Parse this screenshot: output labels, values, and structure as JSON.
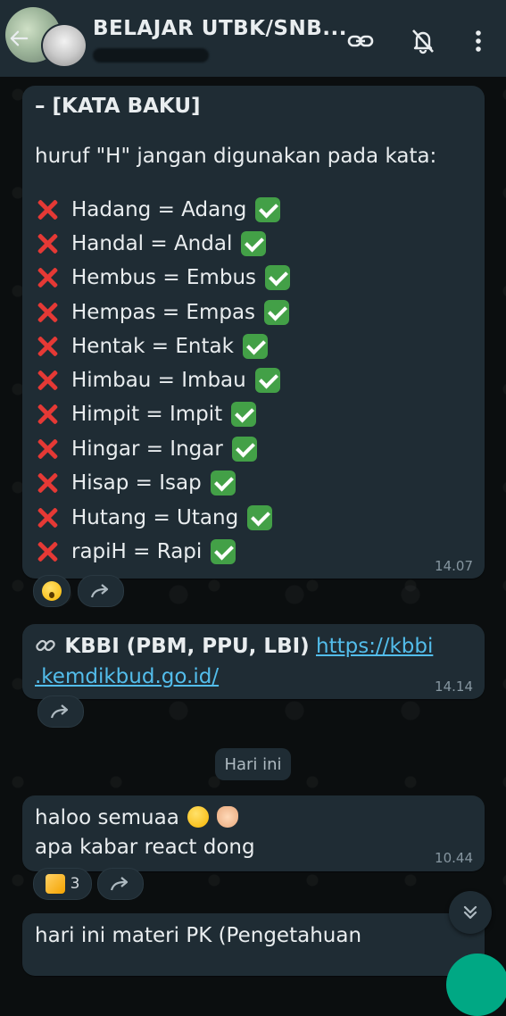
{
  "header": {
    "title": "BELAJAR UTBK/SNB...",
    "icons": [
      "back-arrow-icon",
      "link-icon",
      "bell-off-icon",
      "more-vert-icon"
    ]
  },
  "messages": {
    "m1": {
      "heading": "– [KATA BAKU]",
      "intro": "huruf \"H\" jangan digunakan pada kata:",
      "rules": [
        "Hadang = Adang",
        "Handal = Andal",
        "Hembus = Embus",
        "Hempas = Empas",
        "Hentak = Entak",
        "Himbau = Imbau",
        "Himpit = Impit",
        "Hingar = Ingar",
        "Hisap = Isap",
        "Hutang = Utang",
        "rapiH = Rapi"
      ],
      "time": "14.07",
      "reaction": "hushed-face-emoji"
    },
    "m2": {
      "prefix": "KBBI (PBM, PPU, LBI)",
      "link_line1": "https://kbbi",
      "link_line2": ".kemdikbud.go.id/",
      "time": "14.14"
    },
    "date_separator": "Hari ini",
    "m3": {
      "line1": "haloo semuaa",
      "line2": "apa kabar react dong",
      "time": "10.44",
      "reaction_count": "3"
    },
    "m4": {
      "line1": "hari ini materi PK (Pengetahuan"
    }
  },
  "colors": {
    "bubble": "#1f2c34",
    "header": "#1f2c34",
    "link": "#53bdeb",
    "accent": "#00a884"
  }
}
